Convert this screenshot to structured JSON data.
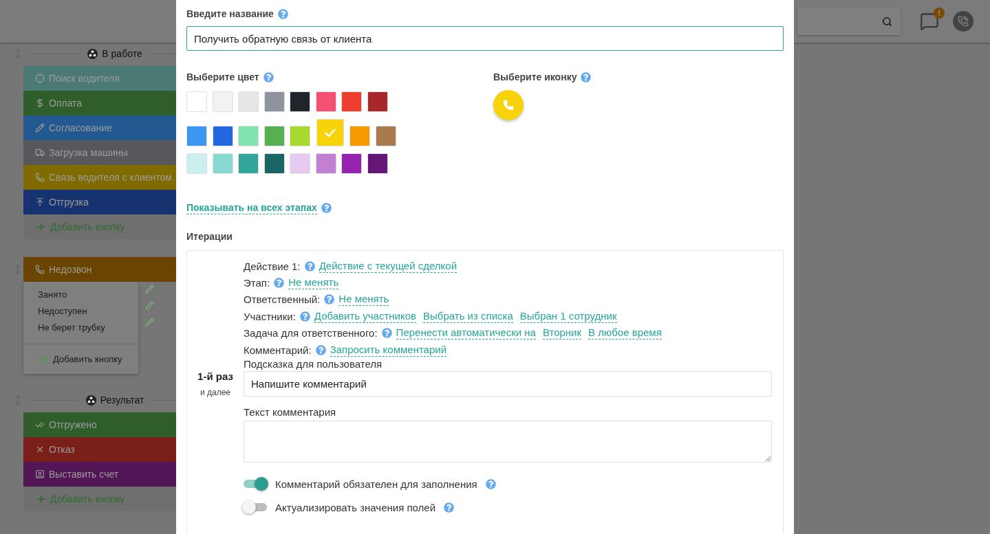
{
  "header": {
    "notification_badge": "!"
  },
  "stages": [
    {
      "kind": "group",
      "title": "В работе",
      "buttons": [
        {
          "label": "Поиск водителя",
          "color": "#4a7a73"
        },
        {
          "label": "Оплата",
          "color": "#2f5e2b"
        },
        {
          "label": "Согласование",
          "color": "#235990"
        },
        {
          "label": "Загрузка машины",
          "color": "#56585c"
        },
        {
          "label": "Связь водителя с клиентом",
          "color": "#806b00"
        },
        {
          "label": "Отгрузка",
          "color": "#17336f"
        }
      ],
      "add_label": "Добавить кнопку"
    },
    {
      "kind": "dropdown",
      "title": "Недозвон",
      "color": "#6b4500",
      "options": [
        "Занято",
        "Недоступен",
        "Не берет трубку"
      ],
      "add_label": "Добавить кнопку"
    },
    {
      "kind": "group",
      "title": "Результат",
      "buttons": [
        {
          "label": "Отгружено",
          "color": "#2f5e2b"
        },
        {
          "label": "Отказ",
          "color": "#7a1f1a"
        },
        {
          "label": "Выставить счет",
          "color": "#521556"
        }
      ],
      "add_label": "Добавить кнопку"
    }
  ],
  "dialog": {
    "name_label": "Введите название",
    "name_value": "Получить обратную связь от клиента",
    "color_label": "Выберите цвет",
    "swatches": [
      {
        "color": "#ffffff",
        "selected": false
      },
      {
        "color": "#f2f2f2",
        "selected": false
      },
      {
        "color": "#e6e6e6",
        "selected": false
      },
      {
        "color": "#8e949e",
        "selected": false
      },
      {
        "color": "#20242b",
        "selected": false
      },
      {
        "color": "#f55273",
        "selected": false
      },
      {
        "color": "#ec3f2f",
        "selected": false
      },
      {
        "color": "#a8282a",
        "selected": false
      },
      {
        "color": "#3d96f2",
        "selected": false
      },
      {
        "color": "#2468e0",
        "selected": false
      },
      {
        "color": "#80e3b0",
        "selected": false
      },
      {
        "color": "#56b052",
        "selected": false
      },
      {
        "color": "#a8d92f",
        "selected": false
      },
      {
        "color": "#f8d30a",
        "selected": true
      },
      {
        "color": "#f59a00",
        "selected": false
      },
      {
        "color": "#a97a4c",
        "selected": false
      },
      {
        "color": "#ccefed",
        "selected": false
      },
      {
        "color": "#89d9d3",
        "selected": false
      },
      {
        "color": "#33a69c",
        "selected": false
      },
      {
        "color": "#1a6565",
        "selected": false
      },
      {
        "color": "#e8c9ef",
        "selected": false
      },
      {
        "color": "#c27fd4",
        "selected": false
      },
      {
        "color": "#9623ad",
        "selected": false
      },
      {
        "color": "#661579",
        "selected": false
      }
    ],
    "icon_label": "Выберите иконку",
    "show_all_stages_link": "Показывать на всех этапах",
    "iterations_label": "Итерации",
    "iteration": {
      "ordinal": "1-й раз",
      "ordinal_note": "и далее",
      "settings": [
        {
          "label": "Действие 1:",
          "links": [
            "Действие с текущей сделкой"
          ]
        },
        {
          "label": "Этап:",
          "links": [
            "Не менять"
          ]
        },
        {
          "label": "Ответственный:",
          "links": [
            "Не менять"
          ]
        },
        {
          "label": "Участники:",
          "links": [
            "Добавить участников",
            "Выбрать из списка",
            "Выбран 1 сотрудник"
          ]
        },
        {
          "label": "Задача для ответственного:",
          "links": [
            "Перенести автоматически на",
            "Вторник",
            "В любое время"
          ]
        },
        {
          "label": "Комментарий:",
          "links": [
            "Запросить комментарий"
          ]
        }
      ],
      "hint_label": "Подсказка для пользователя",
      "hint_placeholder": "Напишите комментарий",
      "comment_label": "Текст комментария",
      "toggles": [
        {
          "label": "Комментарий обязателен для заполнения",
          "on": true
        },
        {
          "label": "Актуализировать значения полей",
          "on": false
        }
      ]
    }
  }
}
